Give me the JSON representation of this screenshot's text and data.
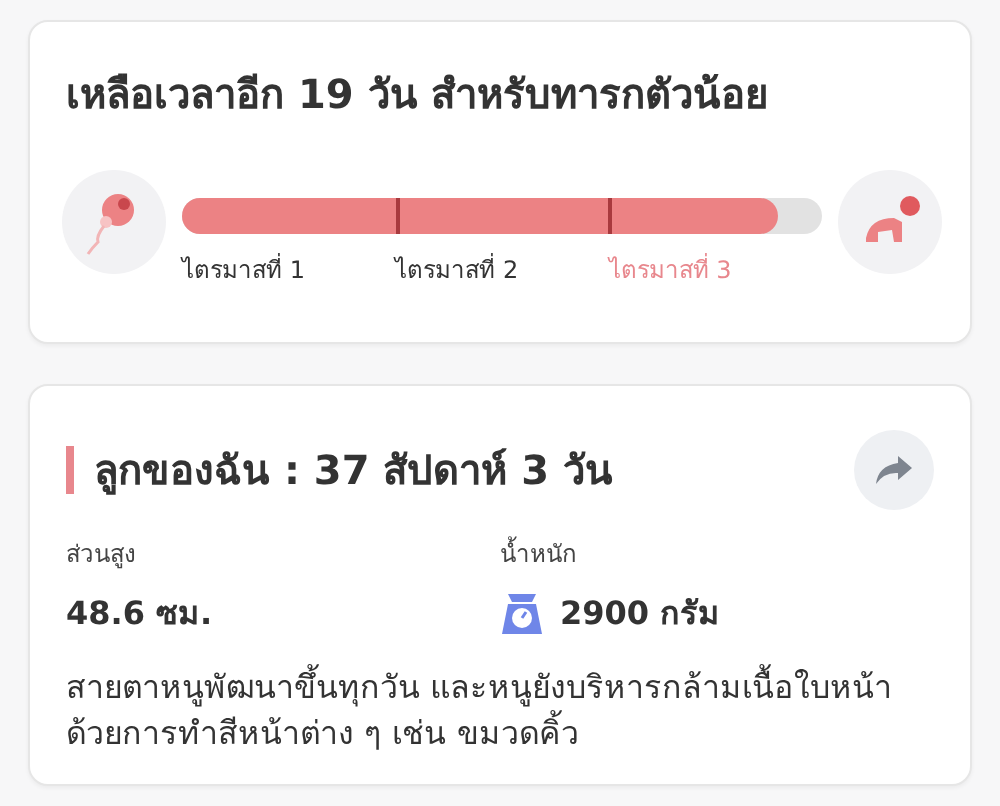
{
  "countdown": {
    "title": "เหลือเวลาอีก 19 วัน สำหรับทารกตัวน้อย",
    "progress": {
      "level": 0.93
    },
    "trimesters": [
      {
        "label": "ไตรมาสที่ 1",
        "selected": false
      },
      {
        "label": "ไตรมาสที่ 2",
        "selected": false
      },
      {
        "label": "ไตรมาสที่ 3",
        "selected": true
      }
    ]
  },
  "baby": {
    "title": "ลูกของฉัน : 37 สัปดาห์ 3  วัน",
    "stats": [
      {
        "kind": "height",
        "label": "ส่วนสูง",
        "value": "48.6 ซม."
      },
      {
        "kind": "weight",
        "label": "น้ำหนัก",
        "value": "2900 กรัม"
      }
    ],
    "description": "สายตาหนูพัฒนาขึ้นทุกวัน และหนูยังบริหารกล้ามเนื้อใบหน้าด้วยการทำสีหน้าต่าง ๆ เช่น ขมวดคิ้ว"
  }
}
